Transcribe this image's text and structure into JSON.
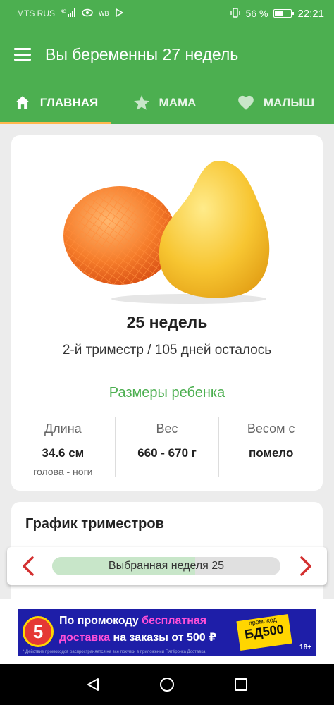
{
  "status_bar": {
    "carrier": "MTS RUS",
    "network_type": "4G",
    "wb": "WB",
    "battery_percent": "56 %",
    "battery_level": 0.56,
    "time": "22:21"
  },
  "app_bar": {
    "title": "Вы беременны 27 недель"
  },
  "tabs": [
    {
      "label": "ГЛАВНАЯ",
      "icon": "home-icon",
      "active": true
    },
    {
      "label": "МАМА",
      "icon": "star-icon",
      "active": false
    },
    {
      "label": "МАЛЫШ",
      "icon": "heart-icon",
      "active": false
    }
  ],
  "colors": {
    "primary": "#4caf50",
    "tab_indicator": "#ffb74d",
    "arrow": "#d32f2f"
  },
  "week_card": {
    "image": "pomelo-fruit",
    "week_title": "25 недель",
    "trimester_text": "2-й триместр / 105 дней осталось",
    "sizes_title": "Размеры ребенка",
    "stats": [
      {
        "label": "Длина",
        "value": "34.6 см",
        "sub": "голова - ноги"
      },
      {
        "label": "Вес",
        "value": "660 - 670 г",
        "sub": ""
      },
      {
        "label": "Весом с",
        "value": "помело",
        "sub": ""
      }
    ]
  },
  "trimester_chart": {
    "heading": "График триместров"
  },
  "week_selector": {
    "text": "Выбранная неделя 25",
    "progress_fraction": 0.625
  },
  "ad_banner": {
    "logo_text": "5",
    "line1_prefix": "По промокоду ",
    "line1_highlight": "бесплатная",
    "line2_highlight": "доставка",
    "line2_suffix": " на заказы от 500 ₽",
    "promo_small": "промокод",
    "promo_code": "БД500",
    "age": "18+",
    "disclaimer": "* Действие промокодов распространяется на все покупки в приложении Пятёрочка Доставка"
  }
}
